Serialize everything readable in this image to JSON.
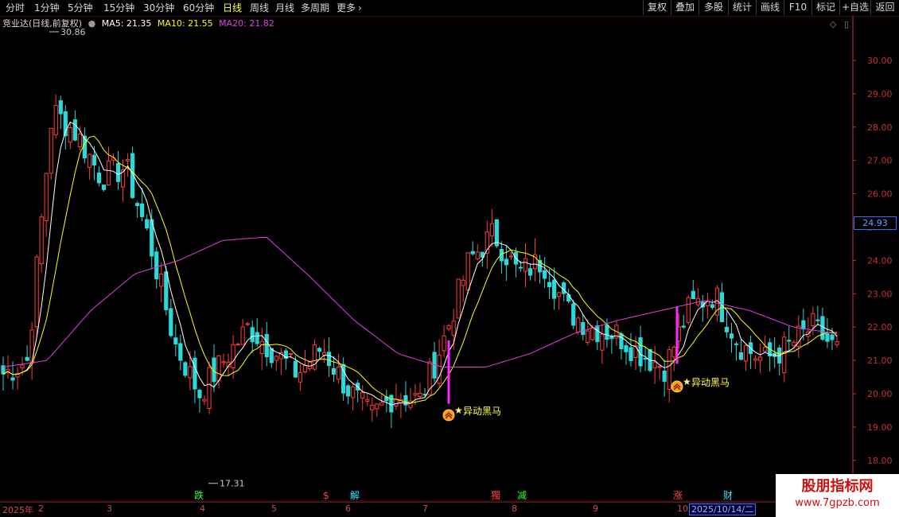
{
  "toolbar": {
    "periods": [
      "分时",
      "1分钟",
      "5分钟",
      "15分钟",
      "30分钟",
      "60分钟",
      "日线",
      "周线",
      "月线",
      "多周期",
      "更多"
    ],
    "more_arrow": "›",
    "buttons": [
      "复权",
      "叠加",
      "多股",
      "统计",
      "画线",
      "F10",
      "标记",
      "+自选",
      "返回"
    ]
  },
  "legend": {
    "stock_name": "竞业达(日线,前复权)",
    "ma5": "MA5: 21.35",
    "ma10": "MA10: 21.55",
    "ma20": "MA20: 21.82"
  },
  "colors": {
    "up": "#ff3c3c",
    "down": "#2cd8d8",
    "ma5": "#ffffff",
    "ma10": "#ffff00",
    "ma20": "#e040e0",
    "axis": "#c83030",
    "signal": "#ff2aff",
    "signal_text": "#ffff55",
    "date_highlight": "#4a6aff"
  },
  "icons": [
    "diamond-icon",
    "panel-toggle-icon",
    "star-icon",
    "double-chevron-up-icon"
  ],
  "y_axis": {
    "labels": [
      "30.00",
      "29.00",
      "28.00",
      "27.00",
      "26.00",
      "25.00",
      "24.00",
      "23.00",
      "22.00",
      "21.00",
      "20.00",
      "19.00",
      "18.00"
    ],
    "current_price": "24.93"
  },
  "annotations": {
    "high": "30.86",
    "low": "17.31",
    "signal_label": "异动黑马"
  },
  "event_markers": [
    {
      "text": "跌",
      "color": "#30ff30"
    },
    {
      "text": "$",
      "color": "#ff4040"
    },
    {
      "text": "解",
      "color": "#30e8ff"
    },
    {
      "text": "獨",
      "color": "#ff4040"
    },
    {
      "text": "减",
      "color": "#30ff30"
    },
    {
      "text": "涨",
      "color": "#ff4040"
    },
    {
      "text": "财",
      "color": "#30e8ff"
    }
  ],
  "date_axis": {
    "months": [
      "2025年",
      "2",
      "3",
      "4",
      "5",
      "6",
      "7",
      "8",
      "9",
      "10"
    ],
    "cursor_date": "2025/10/14/二"
  },
  "watermark": {
    "title": "股朋指标网",
    "url": "www.7gpzb.com"
  },
  "chart_data": {
    "type": "candlestick",
    "title": "竞业达(日线,前复权)",
    "x": [
      "2025-01",
      "2025-02",
      "2025-03",
      "2025-04",
      "2025-05",
      "2025-06",
      "2025-07",
      "2025-08",
      "2025-09",
      "2025-10"
    ],
    "ylim": [
      17.5,
      31
    ],
    "y_ticks": [
      18,
      19,
      20,
      21,
      22,
      23,
      24,
      25,
      26,
      27,
      28,
      29,
      30
    ],
    "high_mark": 30.86,
    "low_mark": 17.31,
    "current": 24.93,
    "series": [
      {
        "name": "MA5",
        "last": 21.35
      },
      {
        "name": "MA10",
        "last": 21.55
      },
      {
        "name": "MA20",
        "last": 21.82,
        "shape": [
          20.8,
          21.0,
          22.5,
          23.6,
          24.0,
          24.6,
          24.7,
          23.5,
          22.2,
          21.2,
          20.8,
          20.8,
          21.2,
          21.8,
          22.2,
          22.5,
          22.8,
          22.5,
          22.0,
          21.8
        ]
      }
    ],
    "path": [
      20.6,
      21.0,
      28.5,
      27.8,
      26.5,
      26.8,
      24.5,
      21.5,
      20.0,
      21.0,
      22.0,
      21.3,
      20.6,
      21.4,
      20.2,
      19.3,
      20.0,
      19.8,
      21.7,
      24.0,
      24.8,
      23.6,
      24.0,
      22.5,
      22.0,
      21.8,
      21.2,
      20.8,
      22.6,
      23.0,
      21.5,
      21.0,
      21.4,
      22.0,
      21.3
    ]
  }
}
